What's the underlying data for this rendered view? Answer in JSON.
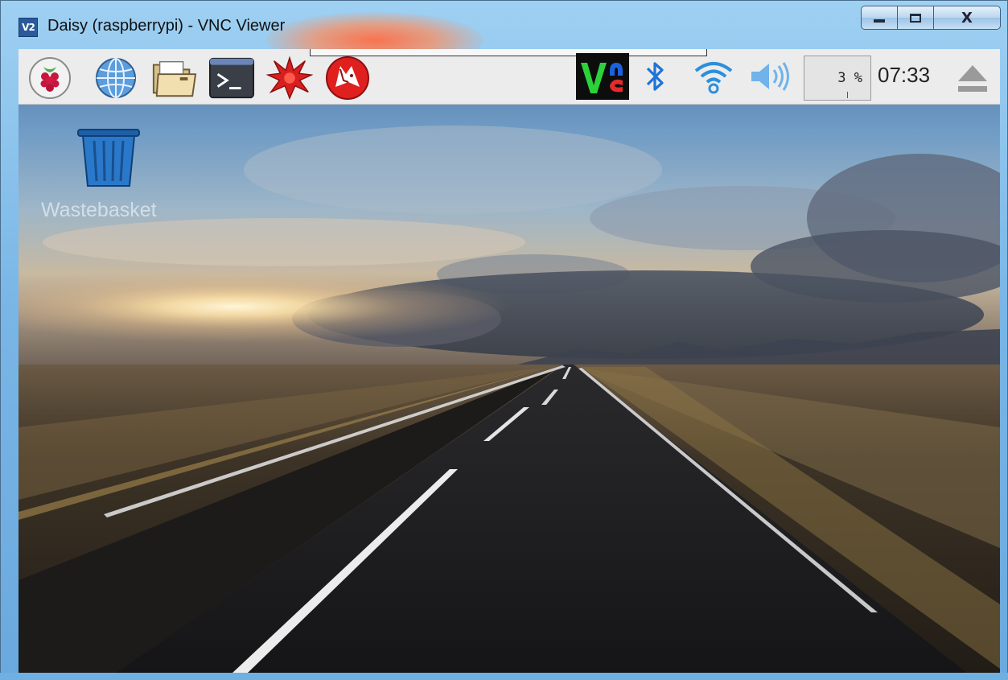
{
  "window": {
    "app_icon_text": "V2",
    "title": "Daisy (raspberrypi) - VNC Viewer",
    "controls": {
      "minimize": "minimize",
      "maximize": "maximize",
      "close": "X"
    }
  },
  "panel": {
    "launchers": [
      {
        "name": "raspberry-menu-icon"
      },
      {
        "name": "web-browser-icon"
      },
      {
        "name": "file-manager-icon"
      },
      {
        "name": "terminal-icon"
      },
      {
        "name": "mathematica-icon"
      },
      {
        "name": "wolfram-icon"
      }
    ],
    "tray": {
      "vnc_icon": "vnc-server-icon",
      "bluetooth_icon": "bluetooth-icon",
      "wifi_icon": "wifi-icon",
      "volume_icon": "volume-icon",
      "cpu_usage": "3 %",
      "clock": "07:33",
      "eject_icon": "eject-icon"
    },
    "colors": {
      "panel_bg": "#ececec",
      "vnc_red": "#e52a2a",
      "vnc_green": "#2bd23a",
      "bt_blue": "#1e73d6"
    }
  },
  "desktop": {
    "icons": [
      {
        "label": "Wastebasket",
        "icon": "trash-can-icon"
      }
    ]
  }
}
